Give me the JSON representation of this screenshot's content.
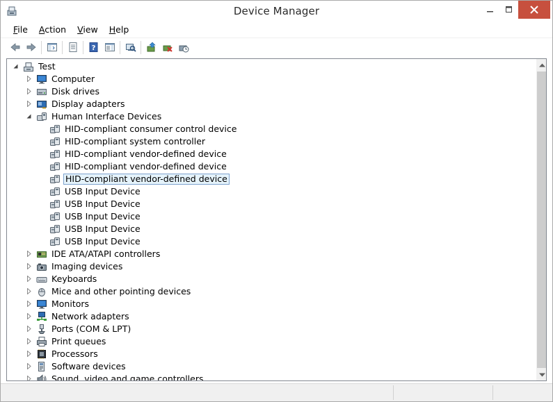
{
  "window": {
    "title": "Device Manager"
  },
  "menu": [
    {
      "label": "File",
      "mnemonic": "F",
      "rest": "ile"
    },
    {
      "label": "Action",
      "mnemonic": "A",
      "rest": "ction"
    },
    {
      "label": "View",
      "mnemonic": "V",
      "rest": "iew"
    },
    {
      "label": "Help",
      "mnemonic": "H",
      "rest": "elp"
    }
  ],
  "toolbar": [
    {
      "icon": "back-arrow-icon"
    },
    {
      "icon": "forward-arrow-icon"
    },
    {
      "sep": true
    },
    {
      "icon": "show-hide-console-tree-icon"
    },
    {
      "sep": true
    },
    {
      "icon": "properties-icon"
    },
    {
      "sep": true
    },
    {
      "icon": "help-icon"
    },
    {
      "icon": "action-pane-icon"
    },
    {
      "sep": true
    },
    {
      "icon": "scan-hardware-changes-icon"
    },
    {
      "sep": true
    },
    {
      "icon": "update-driver-icon"
    },
    {
      "icon": "uninstall-device-icon"
    },
    {
      "icon": "enable-device-icon"
    }
  ],
  "tree": {
    "root": {
      "label": "Test",
      "icon": "computer-root-icon"
    },
    "nodes": [
      {
        "label": "Computer",
        "icon": "monitor-icon",
        "expanded": false,
        "children": []
      },
      {
        "label": "Disk drives",
        "icon": "disk-drive-icon",
        "expanded": false,
        "children": []
      },
      {
        "label": "Display adapters",
        "icon": "display-adapter-icon",
        "expanded": false,
        "children": []
      },
      {
        "label": "Human Interface Devices",
        "icon": "hid-icon",
        "expanded": true,
        "children": [
          {
            "label": "HID-compliant consumer control device"
          },
          {
            "label": "HID-compliant system controller"
          },
          {
            "label": "HID-compliant vendor-defined device"
          },
          {
            "label": "HID-compliant vendor-defined device"
          },
          {
            "label": "HID-compliant vendor-defined device",
            "selected": true
          },
          {
            "label": "USB Input Device"
          },
          {
            "label": "USB Input Device"
          },
          {
            "label": "USB Input Device"
          },
          {
            "label": "USB Input Device"
          },
          {
            "label": "USB Input Device"
          }
        ]
      },
      {
        "label": "IDE ATA/ATAPI controllers",
        "icon": "ide-controller-icon",
        "expanded": false,
        "children": []
      },
      {
        "label": "Imaging devices",
        "icon": "camera-icon",
        "expanded": false,
        "children": []
      },
      {
        "label": "Keyboards",
        "icon": "keyboard-icon",
        "expanded": false,
        "children": []
      },
      {
        "label": "Mice and other pointing devices",
        "icon": "mouse-icon",
        "expanded": false,
        "children": []
      },
      {
        "label": "Monitors",
        "icon": "monitor-icon",
        "expanded": false,
        "children": []
      },
      {
        "label": "Network adapters",
        "icon": "network-adapter-icon",
        "expanded": false,
        "children": []
      },
      {
        "label": "Ports (COM & LPT)",
        "icon": "port-icon",
        "expanded": false,
        "children": []
      },
      {
        "label": "Print queues",
        "icon": "printer-icon",
        "expanded": false,
        "children": []
      },
      {
        "label": "Processors",
        "icon": "processor-icon",
        "expanded": false,
        "children": []
      },
      {
        "label": "Software devices",
        "icon": "software-device-icon",
        "expanded": false,
        "children": []
      },
      {
        "label": "Sound, video and game controllers",
        "icon": "sound-icon",
        "expanded": false,
        "children": []
      }
    ]
  },
  "colors": {
    "close_button": "#c7503e",
    "selection_border": "#7da2ce",
    "selection_fill": "#e5f3fb"
  }
}
